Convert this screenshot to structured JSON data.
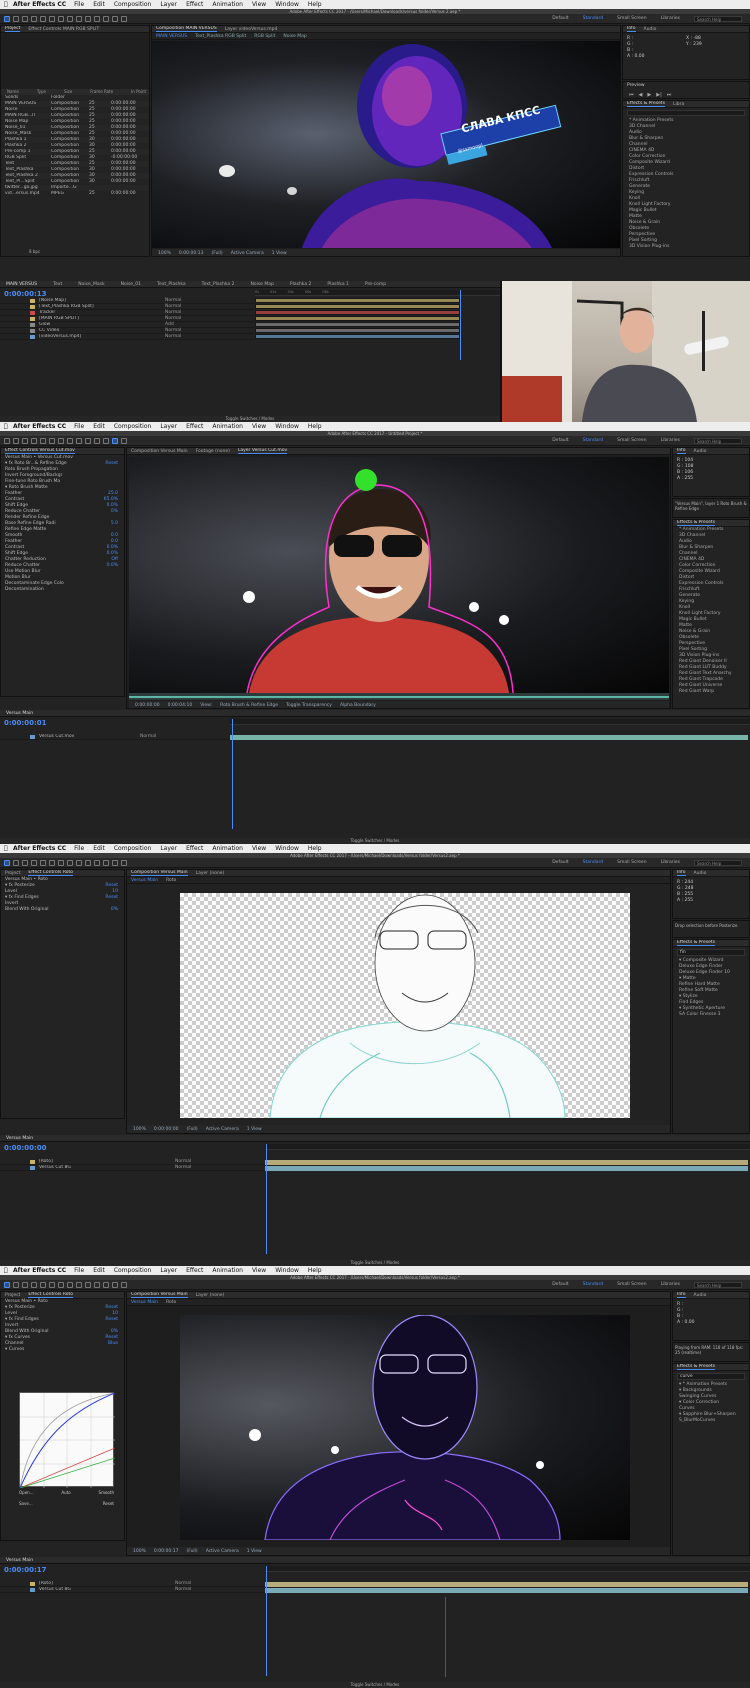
{
  "menu": {
    "app": "After Effects CC",
    "items": [
      "File",
      "Edit",
      "Composition",
      "Layer",
      "Effect",
      "Animation",
      "View",
      "Window",
      "Help"
    ]
  },
  "workspaces": {
    "items": [
      "Default",
      "Standard",
      "Small Screen",
      "Libraries"
    ],
    "active": "Standard",
    "search": "Search Help"
  },
  "shot1": {
    "title": "Adobe After Effects CC 2017 - /Users/Michael/Downloads/versus folder/Versus 2.aep *",
    "project_tab": "Project",
    "effect_tab": "Effect Controls MAIN RGB SPLIT",
    "comp_tab": "Composition MAIN VERSUS",
    "layer_tab": "Layer videoVersus.mp4",
    "viewer_tabs": [
      "MAIN VERSUS",
      "Text_Plashka RGB Split",
      "RGB Split",
      "Noise Map"
    ],
    "columns": [
      "Name",
      "Type",
      "Size",
      "Frame Rate",
      "In Point"
    ],
    "project_items": [
      {
        "name": "Solids",
        "type": "Folder",
        "rate": "",
        "in": ""
      },
      {
        "name": "MAIN VERSUS",
        "type": "Composition",
        "rate": "25",
        "in": "0:00:00:00"
      },
      {
        "name": "Noise",
        "type": "Composition",
        "rate": "25",
        "in": "0:00:00:00"
      },
      {
        "name": "MAIN RGB...IT",
        "type": "Composition",
        "rate": "25",
        "in": "0:00:00:00"
      },
      {
        "name": "Noise Map",
        "type": "Composition",
        "rate": "25",
        "in": "0:00:00:00"
      },
      {
        "name": "Noise_01",
        "type": "Composition",
        "rate": "25",
        "in": "0:00:00:00"
      },
      {
        "name": "Noise_Mask",
        "type": "Composition",
        "rate": "25",
        "in": "0:00:00:00"
      },
      {
        "name": "Plashka 1",
        "type": "Composition",
        "rate": "30",
        "in": "0:00:00:00"
      },
      {
        "name": "Plashka 2",
        "type": "Composition",
        "rate": "30",
        "in": "0:00:00:00"
      },
      {
        "name": "Pre-comp 1",
        "type": "Composition",
        "rate": "25",
        "in": "0:00:00:00"
      },
      {
        "name": "RGB Split",
        "type": "Composition",
        "rate": "30",
        "in": "-0:00:00:00"
      },
      {
        "name": "Text",
        "type": "Composition",
        "rate": "25",
        "in": "0:00:00:00"
      },
      {
        "name": "Text_Plashka",
        "type": "Composition",
        "rate": "30",
        "in": "0:00:00:00"
      },
      {
        "name": "Text_Plashka 2",
        "type": "Composition",
        "rate": "30",
        "in": "0:00:00:00"
      },
      {
        "name": "Text_Pl...Split",
        "type": "Composition",
        "rate": "30",
        "in": "0:00:00:00"
      },
      {
        "name": "twitter...go.jpg",
        "type": "Importe...G",
        "rate": "",
        "in": ""
      },
      {
        "name": "vid...ersus.mp4",
        "type": "MPEG",
        "rate": "25",
        "in": "0:00:00:00"
      }
    ],
    "bpc": "8 bpc",
    "banner_text": "СЛАВА КПСС",
    "banner_handle": "@ssmonpl",
    "viewer_zoom": "100%",
    "viewer_time": "0:00:00:13",
    "viewer_res": "(Full)",
    "camera": "Active Camera",
    "view": "1 View",
    "tl_tabs": [
      "MAIN VERSUS",
      "Text",
      "Noise_Mask",
      "Noise_01",
      "Text_Plashka",
      "Text_Plashka 2",
      "Noise Map",
      "Plashka 2",
      "Plashka 1",
      "Pre-comp"
    ],
    "tl_time": "0:00:00:13",
    "layers": [
      {
        "name": "[Noise Map]",
        "mode": "Normal",
        "color": "#c9b36a"
      },
      {
        "name": "[Text_Plashka RGB Split]",
        "mode": "Normal",
        "color": "#c9b36a"
      },
      {
        "name": "Tracker",
        "mode": "Normal",
        "color": "#c94b4b"
      },
      {
        "name": "[MAIN RGB SPLIT]",
        "mode": "Normal",
        "color": "#c9b36a"
      },
      {
        "name": "Glow",
        "mode": "Add",
        "color": "#8a8a8a"
      },
      {
        "name": "CC Video",
        "mode": "Normal",
        "color": "#8a8a8a"
      },
      {
        "name": "[videoVersus.mp4]",
        "mode": "Normal",
        "color": "#6a9ac9"
      }
    ],
    "toggle": "Toggle Switches / Modes",
    "info": {
      "R": "R :",
      "G": "G :",
      "B": "B :",
      "A": "A : 0.00",
      "X": "X : -88",
      "Y": "Y : 239"
    },
    "preview": "Preview",
    "effects_tab": "Effects & Presets",
    "effects": [
      "* Animation Presets",
      "3D Channel",
      "Audio",
      "Blur & Sharpen",
      "Channel",
      "CINEMA 4D",
      "Color Correction",
      "Composite Wizard",
      "Distort",
      "Expression Controls",
      "Frischluft",
      "Generate",
      "Keying",
      "Knoll",
      "Knoll Light Factory",
      "Magic Bullet",
      "Matte",
      "Noise & Grain",
      "Obsolete",
      "Perspective",
      "Pixel Sorting",
      "3D Vision Plug-ins"
    ]
  },
  "shot2": {
    "title": "Adobe After Effects CC 2017 - Untitled Project *",
    "effect_tab": "Effect Controls Versus Cut.mov",
    "comp_tab": "Composition Versus Main",
    "footage_tab": "Footage (none)",
    "layer_tab": "Layer Versus Cut.mov",
    "effect_items": [
      {
        "label": "Versus Main • Versus Cut.mov",
        "value": ""
      },
      {
        "label": "▾ fx Roto Br...& Refine Edge",
        "value": "Reset"
      },
      {
        "label": "  Roto Brush Propagation",
        "value": ""
      },
      {
        "label": "  Invert Foreground/Backgr",
        "value": ""
      },
      {
        "label": "  Fine-tune Roto Brush Ma",
        "value": ""
      },
      {
        "label": "  ▾ Roto Brush Matte",
        "value": ""
      },
      {
        "label": "    Feather",
        "value": "25.0"
      },
      {
        "label": "    Contrast",
        "value": "65.0%"
      },
      {
        "label": "    Shift Edge",
        "value": "0.0%"
      },
      {
        "label": "    Reduce Chatter",
        "value": "0%"
      },
      {
        "label": "  Render Refine Edge",
        "value": ""
      },
      {
        "label": "  Base Refine Edge Radi",
        "value": "5.0"
      },
      {
        "label": "  Refine Edge Matte",
        "value": ""
      },
      {
        "label": "    Smooth",
        "value": "0.0"
      },
      {
        "label": "    Feather",
        "value": "0.0"
      },
      {
        "label": "    Contrast",
        "value": "0.0%"
      },
      {
        "label": "    Shift Edge",
        "value": "0.0%"
      },
      {
        "label": "    Chatter Reduction",
        "value": "Off"
      },
      {
        "label": "    Reduce Chatter",
        "value": "0.0%"
      },
      {
        "label": "  Use Motion Blur",
        "value": ""
      },
      {
        "label": "  Motion Blur",
        "value": ""
      },
      {
        "label": "  Decontaminate Edge Colo",
        "value": ""
      },
      {
        "label": "  Decontamination",
        "value": ""
      }
    ],
    "viewer_zoom": "100%",
    "viewer_time": "0:00:00:01",
    "view_label": "View:",
    "view_value": "Roto Brush & Refine Edge",
    "toggles": [
      "Toggle Transparency",
      "Alpha Boundary"
    ],
    "frame_start": "0:00:00:00",
    "frame_end": "0:00:04:10",
    "tl_tab": "Versus Main",
    "tl_time": "0:00:00:01",
    "layers": [
      {
        "name": "Versus Cut.mov",
        "mode": "Normal",
        "color": "#6a9ac9"
      }
    ],
    "toggle": "Toggle Switches / Modes",
    "info": {
      "R": "R : 104",
      "G": "G : 108",
      "B": "B : 106",
      "A": "A : 255",
      "X": "X : 604",
      "Y": "Y : 307"
    },
    "info_note": "\"Versus Main\", layer 1 Roto Brush & Refine Edge",
    "effects": [
      "* Animation Presets",
      "3D Channel",
      "Audio",
      "Blur & Sharpen",
      "Channel",
      "CINEMA 4D",
      "Color Correction",
      "Composite Wizard",
      "Distort",
      "Expression Controls",
      "Frischluft",
      "Generate",
      "Keying",
      "Knoll",
      "Knoll Light Factory",
      "Magic Bullet",
      "Matte",
      "Noise & Grain",
      "Obsolete",
      "Perspective",
      "Pixel Sorting",
      "3D Vision Plug-ins",
      "Red Giant Denoiser II",
      "Red Giant LUT Buddy",
      "Red Giant Text Anarchy",
      "Red Giant Trapcode",
      "Red Giant Universe",
      "Red Giant Warp"
    ]
  },
  "shot3": {
    "title": "Adobe After Effects CC 2017 - /Users/Michael/Downloads/Versus folder/Versus2.aep *",
    "effect_tab": "Effect Controls Roto",
    "comp_tab": "Composition Versus Main",
    "layer_tab": "Layer (none)",
    "sub_tabs": [
      "Versus Main",
      "Roto"
    ],
    "effect_items": [
      {
        "label": "Versus Main • Roto",
        "value": ""
      },
      {
        "label": "▾ fx Posterize",
        "value": "Reset"
      },
      {
        "label": "    Level",
        "value": "10"
      },
      {
        "label": "▾ fx Find Edges",
        "value": "Reset"
      },
      {
        "label": "    Invert",
        "value": ""
      },
      {
        "label": "    Blend With Original",
        "value": "0%"
      }
    ],
    "viewer_zoom": "100%",
    "viewer_time": "0:00:00:00",
    "viewer_res": "(Full)",
    "camera": "Active Camera",
    "view": "1 View",
    "tl_tab": "Versus Main",
    "tl_time": "0:00:00:00",
    "layers": [
      {
        "name": "[Roto]",
        "mode": "Normal",
        "color": "#c9b36a"
      },
      {
        "name": "Versus Cut 8G",
        "mode": "Normal",
        "color": "#6a9ac9"
      }
    ],
    "toggle": "Toggle Switches / Modes",
    "info": {
      "R": "R : 244",
      "G": "G : 248",
      "B": "B : 255",
      "A": "A : 255",
      "X": "X : 413",
      "Y": "Y : 617"
    },
    "info_note": "Drop selection before Posterize",
    "search": "fin",
    "effects": [
      "▾ Composite Wizard",
      "Deluxe Edge Finder",
      "Deluxe Edge Finder 10",
      "▾ Matte",
      "Refine Hard Matte",
      "Refine Soft Matte",
      "▾ Stylize",
      "Find Edges",
      "▾ Synthetic Aperture",
      "SA Color Finesse 3"
    ]
  },
  "shot4": {
    "effect_tab": "Effect Controls Roto",
    "comp_tab": "Composition Versus Main",
    "layer_tab": "Layer (none)",
    "sub_tabs": [
      "Versus Main",
      "Roto"
    ],
    "effect_items": [
      {
        "label": "Versus Main • Roto",
        "value": ""
      },
      {
        "label": "▾ fx Posterize",
        "value": "Reset"
      },
      {
        "label": "    Level",
        "value": "10"
      },
      {
        "label": "▾ fx Find Edges",
        "value": "Reset"
      },
      {
        "label": "    Invert",
        "value": ""
      },
      {
        "label": "    Blend With Original",
        "value": "0%"
      },
      {
        "label": "▾ fx Curves",
        "value": "Reset"
      },
      {
        "label": "    Channel",
        "value": "Blue"
      },
      {
        "label": "  ▾ Curves",
        "value": ""
      }
    ],
    "curve_buttons": [
      "Open...",
      "Auto",
      "Smooth",
      "Save...",
      "Reset"
    ],
    "viewer_zoom": "100%",
    "viewer_time": "0:00:00:17",
    "viewer_res": "(Full)",
    "camera": "Active Camera",
    "view": "1 View",
    "tl_tab": "Versus Main",
    "tl_time": "0:00:00:17",
    "layers": [
      {
        "name": "[Roto]",
        "mode": "Normal",
        "color": "#c9b36a"
      },
      {
        "name": "Versus Cut 8G",
        "mode": "Normal",
        "color": "#6a9ac9"
      }
    ],
    "toggle": "Toggle Switches / Modes",
    "info": {
      "R": "R :",
      "G": "G :",
      "B": "B :",
      "A": "A : 0.00",
      "X": "X : 607",
      "Y": "Y : 773"
    },
    "info_note": "Playing from RAM: 118 of 118 fps: 25 (realtime)",
    "search": "curve",
    "effects": [
      "▾ * Animation Presets",
      "▾ Backgrounds",
      "Swinging Curves",
      "▾ Color Correction",
      "Curves",
      "▾ Sapphire Blur+Sharpen",
      "S_BlurMoCurves"
    ]
  }
}
